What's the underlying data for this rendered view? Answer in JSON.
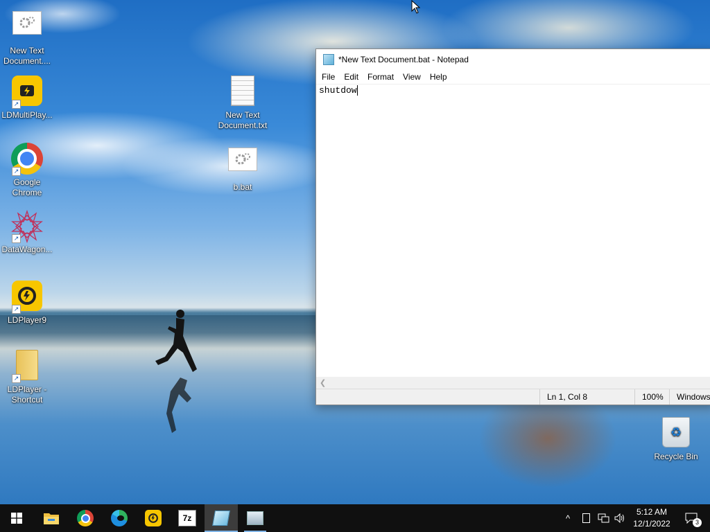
{
  "desktop": {
    "icons": [
      {
        "label": "New Text Document....",
        "icon": "batch-file-icon"
      },
      {
        "label": "LDMultiPlay...",
        "icon": "ldmultiplayer-icon"
      },
      {
        "label": "Google Chrome",
        "icon": "chrome-icon"
      },
      {
        "label": "DataWagon...",
        "icon": "datawagon-icon"
      },
      {
        "label": "LDPlayer9",
        "icon": "ldplayer-icon"
      },
      {
        "label": "LDPlayer - Shortcut",
        "icon": "folder-icon"
      },
      {
        "label": "New Text Document.txt",
        "icon": "text-file-icon"
      },
      {
        "label": "b.bat",
        "icon": "batch-file-icon"
      },
      {
        "label": "Recycle Bin",
        "icon": "recycle-bin-icon"
      }
    ]
  },
  "notepad": {
    "title": "*New Text Document.bat - Notepad",
    "menu": [
      "File",
      "Edit",
      "Format",
      "View",
      "Help"
    ],
    "content": "shutdow",
    "status": {
      "position": "Ln 1, Col 8",
      "zoom": "100%",
      "line_ending": "Windows"
    }
  },
  "taskbar": {
    "apps": [
      "start-icon",
      "file-explorer-icon",
      "chrome-icon",
      "edge-icon",
      "ldplayer-icon",
      "7zip-icon",
      "notepad-icon",
      "image-viewer-icon"
    ],
    "clock": {
      "time": "5:12 AM",
      "date": "12/1/2022"
    },
    "notifications_count": "3",
    "seven_zip_label": "7z"
  },
  "colors": {
    "taskbar": "#101010",
    "accent": "#7fb4e6",
    "ldplayer_yellow": "#f7c600"
  }
}
